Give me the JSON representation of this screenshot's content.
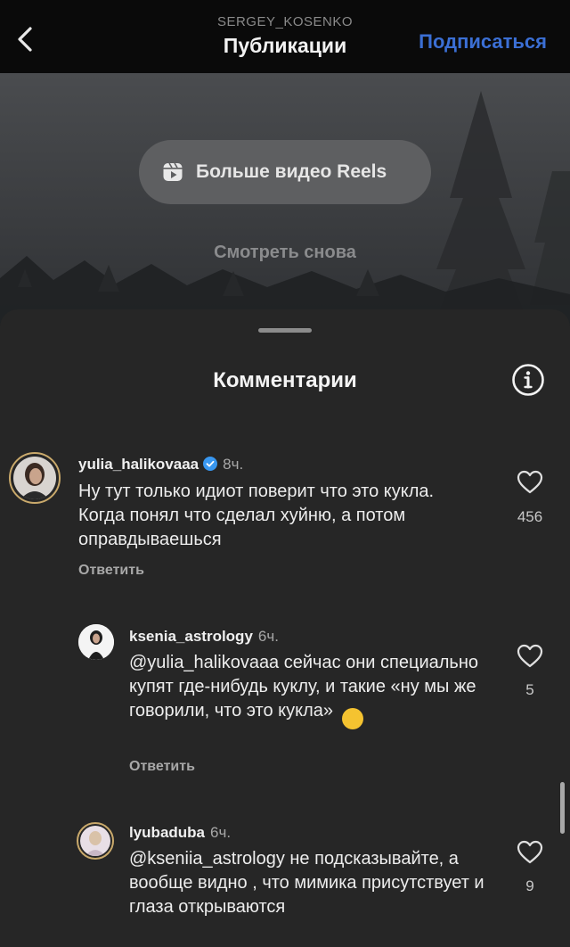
{
  "header": {
    "username": "SERGEY_KOSENKO",
    "title": "Публикации",
    "follow_label": "Подписаться"
  },
  "video": {
    "reels_label": "Больше видео Reels",
    "watch_again_label": "Смотреть снова"
  },
  "comments_sheet": {
    "title": "Комментарии",
    "comments": [
      {
        "username": "yulia_halikovaaa",
        "verified": true,
        "time": "8ч.",
        "text": "Ну тут только идиот поверит что это кукла. Когда понял что сделал хуйню, а потом оправдываешься",
        "reply_label": "Ответить",
        "likes": "456"
      },
      {
        "username": "ksenia_astrology",
        "time": "6ч.",
        "text": "@yulia_halikovaaa сейчас они специально купят где-нибудь куклу, и такие «ну мы же говорили, что это кукла»",
        "emoji": "🥴",
        "reply_label": "Ответить",
        "likes": "5"
      },
      {
        "username": "lyubaduba",
        "time": "6ч.",
        "text": "@kseniia_astrology не подсказывайте, а вообще видно , что мимика присутствует и глаза открываются",
        "likes": "9"
      }
    ]
  },
  "colors": {
    "follow_blue": "#3b6fd4",
    "sheet_bg": "#262626",
    "verified_blue": "#3897f0"
  },
  "icons": [
    "back-chevron-icon",
    "reels-icon",
    "info-icon",
    "verified-icon",
    "heart-icon"
  ]
}
